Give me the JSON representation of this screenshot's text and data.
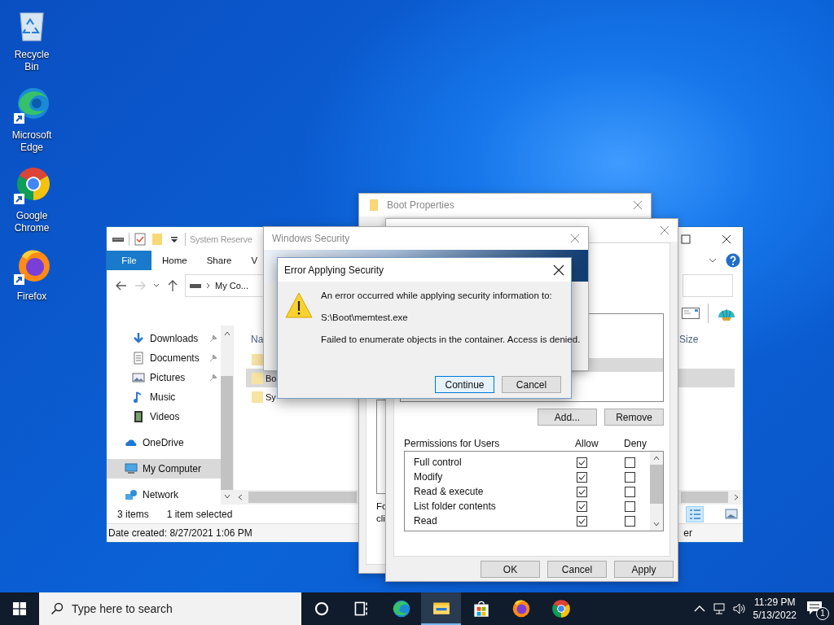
{
  "desktop_icons": [
    {
      "label": "Recycle Bin",
      "kind": "recycle"
    },
    {
      "label": "Microsoft Edge",
      "kind": "edge"
    },
    {
      "label": "Google Chrome",
      "kind": "chrome"
    },
    {
      "label": "Firefox",
      "kind": "firefox"
    }
  ],
  "explorer": {
    "title": "System Reserve",
    "ribbon_tabs": [
      {
        "label": "File",
        "kind": "file"
      },
      {
        "label": "Home",
        "kind": "tab"
      },
      {
        "label": "Share",
        "kind": "tab"
      },
      {
        "label": "V",
        "kind": "tab"
      }
    ],
    "address": "My Co...",
    "nav_pane": {
      "quick_access": [
        {
          "label": "Downloads",
          "kind": "downloads",
          "pinned": true,
          "selected": false
        },
        {
          "label": "Documents",
          "kind": "documents",
          "pinned": true,
          "selected": false
        },
        {
          "label": "Pictures",
          "kind": "pictures",
          "pinned": true,
          "selected": false
        },
        {
          "label": "Music",
          "kind": "music",
          "pinned": false,
          "selected": false
        },
        {
          "label": "Videos",
          "kind": "videos",
          "pinned": false,
          "selected": false
        }
      ],
      "roots": [
        {
          "label": "OneDrive",
          "kind": "cloud",
          "selected": false
        },
        {
          "label": "My Computer",
          "kind": "computer",
          "selected": true
        },
        {
          "label": "Network",
          "kind": "network",
          "selected": false
        }
      ]
    },
    "columns": [
      "Na",
      "Size"
    ],
    "rows": [
      {
        "selected": false
      },
      {
        "name": "Bo",
        "selected": true
      },
      {
        "name": "Sy",
        "selected": false
      }
    ],
    "item_count": "3 items",
    "selection": "1 item selected",
    "details": "Date created: 8/27/2021 1:06 PM",
    "details_right": "er"
  },
  "boot_properties": {
    "title": "Boot Properties",
    "fragments": [
      "Fo",
      "cli"
    ]
  },
  "permissions_window": {
    "user_rows": [
      {
        "selected": false
      },
      {
        "selected": false
      },
      {
        "selected": false
      },
      {
        "selected": true
      },
      {
        "selected": false
      }
    ],
    "list_buttons": [
      "Add...",
      "Remove"
    ],
    "permissions_label": "Permissions for Users",
    "allow_label": "Allow",
    "deny_label": "Deny",
    "permissions": [
      {
        "name": "Full control",
        "allow": true,
        "deny": false
      },
      {
        "name": "Modify",
        "allow": true,
        "deny": false
      },
      {
        "name": "Read & execute",
        "allow": true,
        "deny": false
      },
      {
        "name": "List folder contents",
        "allow": true,
        "deny": false
      },
      {
        "name": "Read",
        "allow": true,
        "deny": false
      }
    ],
    "buttons": [
      "OK",
      "Cancel",
      "Apply"
    ]
  },
  "windows_security": {
    "title": "Windows Security"
  },
  "error_dialog": {
    "title": "Error Applying Security",
    "lines": [
      "An error occurred while applying security information to:",
      "S:\\Boot\\memtest.exe",
      "Failed to enumerate objects in the container. Access is denied."
    ],
    "buttons": [
      {
        "label": "Continue",
        "default": true
      },
      {
        "label": "Cancel",
        "default": false
      }
    ]
  },
  "taskbar": {
    "search_placeholder": "Type here to search",
    "apps": [
      {
        "kind": "cortana",
        "active": false
      },
      {
        "kind": "taskview",
        "active": false
      },
      {
        "kind": "edge",
        "active": false
      },
      {
        "kind": "explorer",
        "active": true
      },
      {
        "kind": "store",
        "active": false
      },
      {
        "kind": "firefox",
        "active": false
      },
      {
        "kind": "chrome",
        "active": false
      }
    ],
    "time": "11:29 PM",
    "date": "5/13/2022",
    "notifications": "1"
  }
}
